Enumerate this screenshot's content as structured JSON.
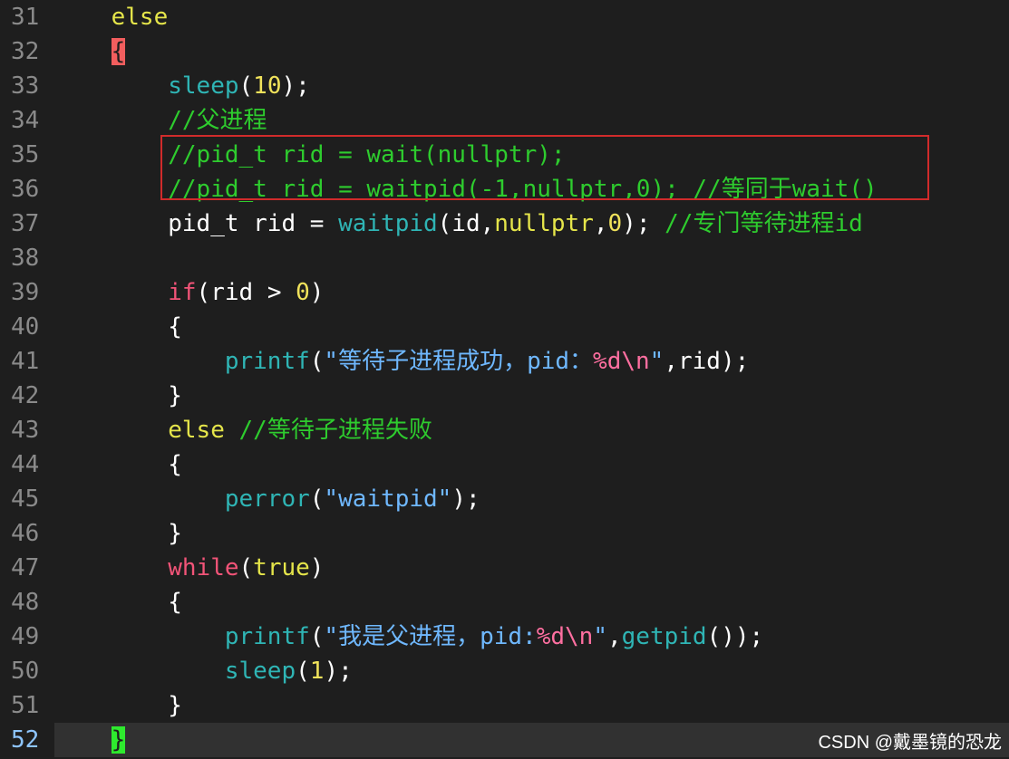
{
  "editor": {
    "lines": [
      {
        "num": "31",
        "tokens": [
          {
            "t": "    "
          },
          {
            "t": "else",
            "c": "kw"
          }
        ]
      },
      {
        "num": "32",
        "tokens": [
          {
            "t": "    "
          },
          {
            "t": "{",
            "c": "brace-hl-red"
          }
        ]
      },
      {
        "num": "33",
        "tokens": [
          {
            "t": "        "
          },
          {
            "t": "sleep",
            "c": "fn"
          },
          {
            "t": "("
          },
          {
            "t": "10",
            "c": "num"
          },
          {
            "t": ");"
          }
        ]
      },
      {
        "num": "34",
        "tokens": [
          {
            "t": "        "
          },
          {
            "t": "//父进程",
            "c": "com"
          }
        ]
      },
      {
        "num": "35",
        "tokens": [
          {
            "t": "        "
          },
          {
            "t": "//pid_t rid = wait(nullptr);",
            "c": "com"
          }
        ]
      },
      {
        "num": "36",
        "tokens": [
          {
            "t": "        "
          },
          {
            "t": "//pid_t rid = waitpid(-1,nullptr,0); //等同于wait()",
            "c": "com"
          }
        ]
      },
      {
        "num": "37",
        "tokens": [
          {
            "t": "        "
          },
          {
            "t": "pid_t rid = "
          },
          {
            "t": "waitpid",
            "c": "fn"
          },
          {
            "t": "(id,"
          },
          {
            "t": "nullptr",
            "c": "kw"
          },
          {
            "t": ","
          },
          {
            "t": "0",
            "c": "num"
          },
          {
            "t": "); "
          },
          {
            "t": "//专门等待进程id",
            "c": "com"
          }
        ]
      },
      {
        "num": "38",
        "tokens": []
      },
      {
        "num": "39",
        "tokens": [
          {
            "t": "        "
          },
          {
            "t": "if",
            "c": "kw-pink"
          },
          {
            "t": "(rid > "
          },
          {
            "t": "0",
            "c": "num"
          },
          {
            "t": ")"
          }
        ]
      },
      {
        "num": "40",
        "tokens": [
          {
            "t": "        "
          },
          {
            "t": "{"
          }
        ]
      },
      {
        "num": "41",
        "tokens": [
          {
            "t": "            "
          },
          {
            "t": "printf",
            "c": "fn"
          },
          {
            "t": "("
          },
          {
            "t": "\"等待子进程成功，pid：",
            "c": "str"
          },
          {
            "t": "%d\\n",
            "c": "fmt"
          },
          {
            "t": "\"",
            "c": "str"
          },
          {
            "t": ",rid);"
          }
        ]
      },
      {
        "num": "42",
        "tokens": [
          {
            "t": "        "
          },
          {
            "t": "}"
          }
        ]
      },
      {
        "num": "43",
        "tokens": [
          {
            "t": "        "
          },
          {
            "t": "else",
            "c": "kw"
          },
          {
            "t": " "
          },
          {
            "t": "//等待子进程失败",
            "c": "com"
          }
        ]
      },
      {
        "num": "44",
        "tokens": [
          {
            "t": "        "
          },
          {
            "t": "{"
          }
        ]
      },
      {
        "num": "45",
        "tokens": [
          {
            "t": "            "
          },
          {
            "t": "perror",
            "c": "fn"
          },
          {
            "t": "("
          },
          {
            "t": "\"waitpid\"",
            "c": "str"
          },
          {
            "t": ");"
          }
        ]
      },
      {
        "num": "46",
        "tokens": [
          {
            "t": "        "
          },
          {
            "t": "}"
          }
        ]
      },
      {
        "num": "47",
        "tokens": [
          {
            "t": "        "
          },
          {
            "t": "while",
            "c": "kw-pink"
          },
          {
            "t": "("
          },
          {
            "t": "true",
            "c": "kw"
          },
          {
            "t": ")"
          }
        ]
      },
      {
        "num": "48",
        "tokens": [
          {
            "t": "        "
          },
          {
            "t": "{"
          }
        ]
      },
      {
        "num": "49",
        "tokens": [
          {
            "t": "            "
          },
          {
            "t": "printf",
            "c": "fn"
          },
          {
            "t": "("
          },
          {
            "t": "\"我是父进程，pid:",
            "c": "str"
          },
          {
            "t": "%d\\n",
            "c": "fmt"
          },
          {
            "t": "\"",
            "c": "str"
          },
          {
            "t": ","
          },
          {
            "t": "getpid",
            "c": "fn"
          },
          {
            "t": "());"
          }
        ]
      },
      {
        "num": "50",
        "tokens": [
          {
            "t": "            "
          },
          {
            "t": "sleep",
            "c": "fn"
          },
          {
            "t": "("
          },
          {
            "t": "1",
            "c": "num"
          },
          {
            "t": ");"
          }
        ]
      },
      {
        "num": "51",
        "tokens": [
          {
            "t": "        "
          },
          {
            "t": "}"
          }
        ]
      },
      {
        "num": "52",
        "tokens": [
          {
            "t": "    "
          },
          {
            "t": "}",
            "c": "brace-hl-green"
          }
        ],
        "current": true
      }
    ]
  },
  "watermark": "CSDN @戴墨镜的恐龙",
  "colors": {
    "background": "#1e1e1e",
    "keyword": "#e5e54a",
    "keyword_control": "#f25478",
    "function": "#2fb5b5",
    "number": "#f0e25b",
    "comment": "#2ecc2e",
    "string": "#6fb8ff",
    "format_specifier": "#ff6fa0",
    "highlight_box": "#d12b2b"
  }
}
